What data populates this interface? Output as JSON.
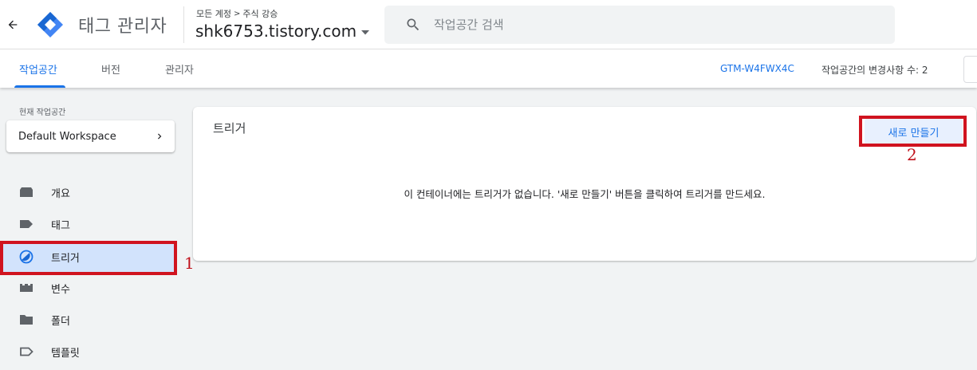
{
  "header": {
    "product_name": "태그 관리자",
    "breadcrumb": {
      "account": "모든 계정",
      "separator": ">",
      "container_scope": "주식 강승"
    },
    "container_name": "shk6753.tistory.com",
    "search": {
      "placeholder": "작업공간 검색",
      "value": ""
    }
  },
  "tabs": [
    {
      "label": "작업공간",
      "active": true
    },
    {
      "label": "버전",
      "active": false
    },
    {
      "label": "관리자",
      "active": false
    }
  ],
  "status_bar": {
    "container_id": "GTM-W4FWX4C",
    "changes_text": "작업공간의 변경사항 수: 2"
  },
  "sidebar": {
    "current_workspace_label": "현재 작업공간",
    "workspace_name": "Default Workspace",
    "items": [
      {
        "label": "개요",
        "icon": "overview-icon",
        "active": false
      },
      {
        "label": "태그",
        "icon": "tag-icon",
        "active": false
      },
      {
        "label": "트리거",
        "icon": "trigger-icon",
        "active": true
      },
      {
        "label": "변수",
        "icon": "variable-icon",
        "active": false
      },
      {
        "label": "폴더",
        "icon": "folder-icon",
        "active": false
      },
      {
        "label": "템플릿",
        "icon": "template-icon",
        "active": false
      }
    ]
  },
  "main": {
    "title": "트리거",
    "new_button_label": "새로 만들기",
    "empty_message": "이 컨테이너에는 트리거가 없습니다. '새로 만들기' 버튼을 클릭하여 트리거를 만드세요."
  },
  "annotations": [
    {
      "label": "1",
      "color": "#d0131f"
    },
    {
      "label": "2",
      "color": "#d0131f"
    }
  ],
  "colors": {
    "accent": "#1a73e8",
    "active_nav_bg": "#d2e3fc",
    "new_button_bg": "#e8f0fe",
    "annotation_red": "#d0131f",
    "logo_blue": "#4285f4",
    "logo_dark_blue": "#1967d2",
    "icon_gray": "#5f6368"
  }
}
